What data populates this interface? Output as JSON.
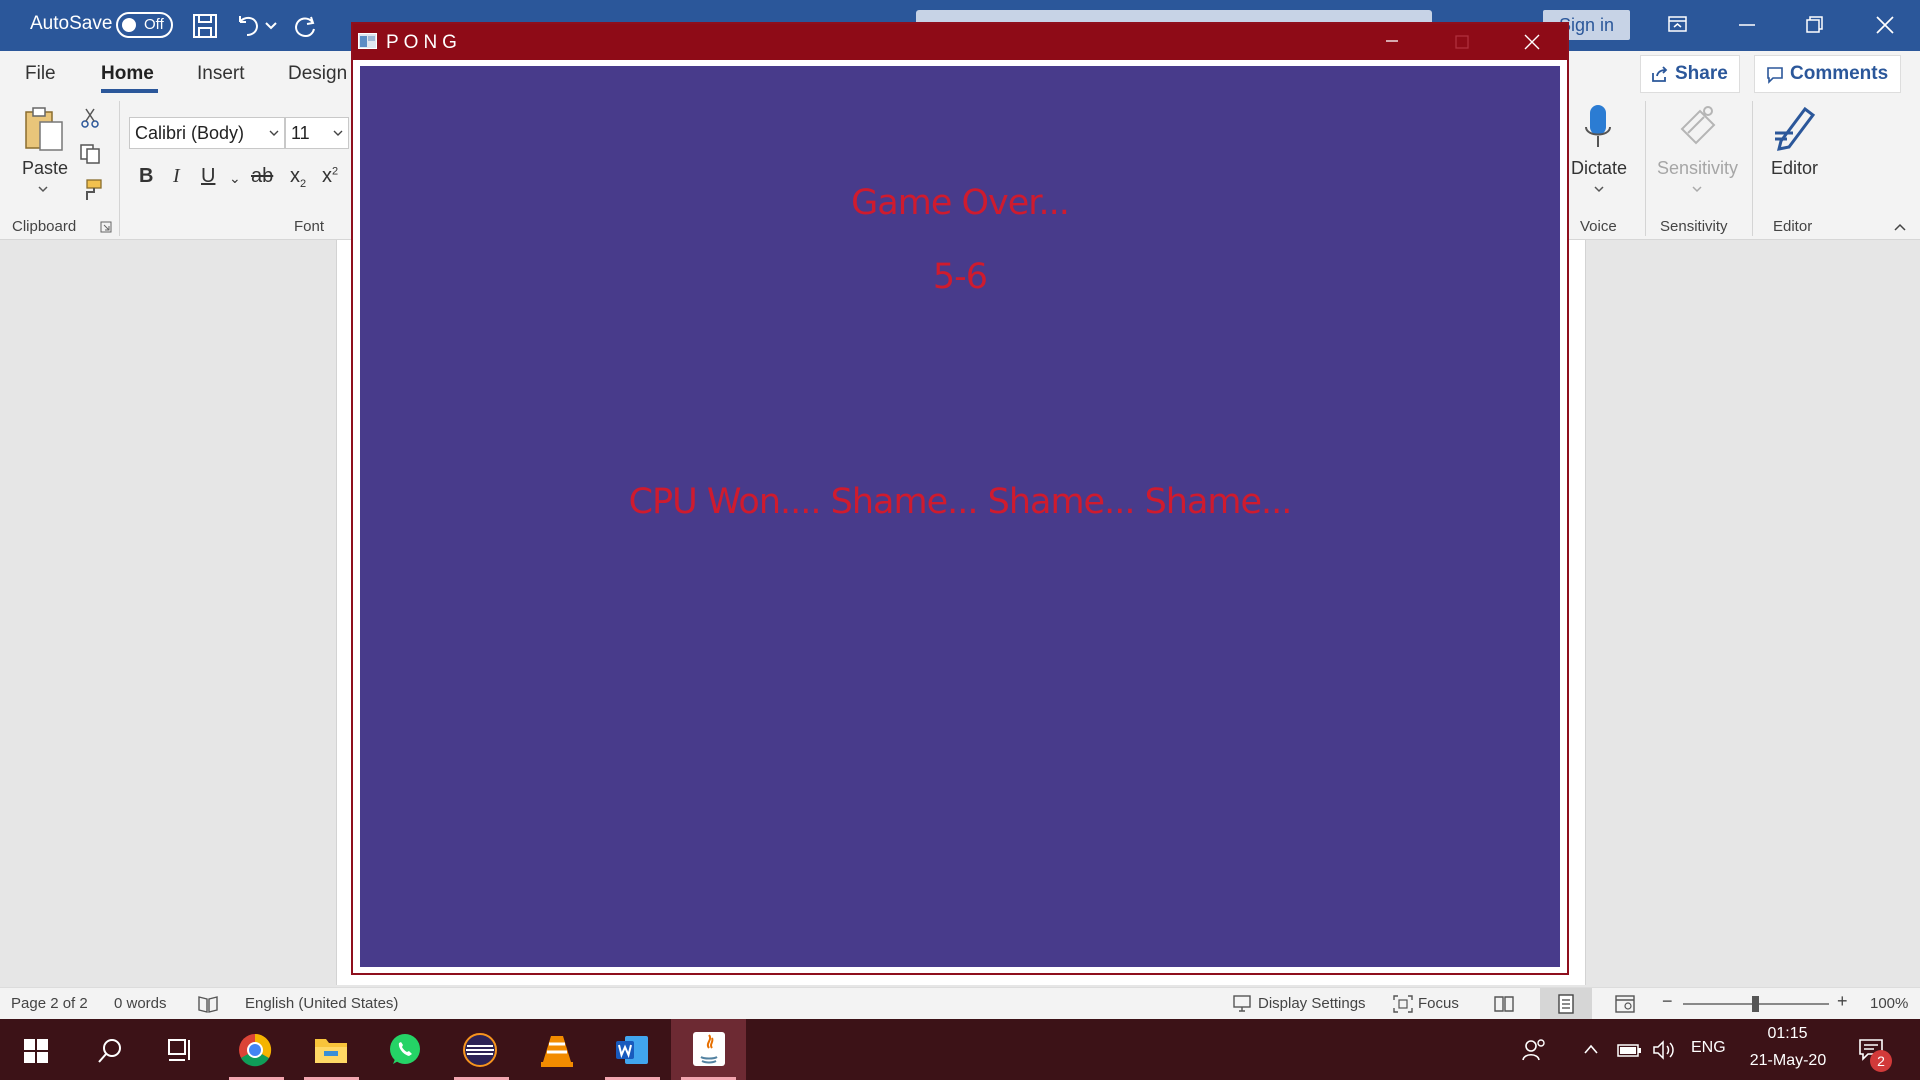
{
  "word": {
    "autosave_label": "AutoSave",
    "autosave_state": "Off",
    "signin_label": "Sign in",
    "tabs": [
      "File",
      "Home",
      "Insert",
      "Design"
    ],
    "share_label": "Share",
    "comments_label": "Comments",
    "clipboard": {
      "paste_label": "Paste",
      "group_label": "Clipboard"
    },
    "font": {
      "family": "Calibri (Body)",
      "size": "11",
      "group_label": "Font"
    },
    "voice": {
      "dictate_label": "Dictate",
      "group_label": "Voice"
    },
    "sensitivity": {
      "button_label": "Sensitivity",
      "group_label": "Sensitivity"
    },
    "editor": {
      "button_label": "Editor",
      "group_label": "Editor"
    },
    "accent_color": "#2b579a"
  },
  "statusbar": {
    "page": "Page 2 of 2",
    "words": "0 words",
    "language": "English (United States)",
    "display_settings": "Display Settings",
    "focus": "Focus",
    "zoom": "100%"
  },
  "pong": {
    "title": "PONG",
    "game_over": "Game Over...",
    "score": "5-6",
    "message": "CPU Won.... Shame... Shame... Shame...",
    "titlebar_color": "#8e0b17",
    "background_color": "#483b8b",
    "text_color": "#cf1b2e"
  },
  "taskbar": {
    "apps": [
      "start-icon",
      "search-icon",
      "task-view-icon",
      "chrome-icon",
      "file-explorer-icon",
      "whatsapp-icon",
      "eclipse-icon",
      "vlc-icon",
      "word-icon",
      "java-icon"
    ],
    "language": "ENG",
    "time": "01:15",
    "date": "21-May-20",
    "notification_count": "2"
  }
}
